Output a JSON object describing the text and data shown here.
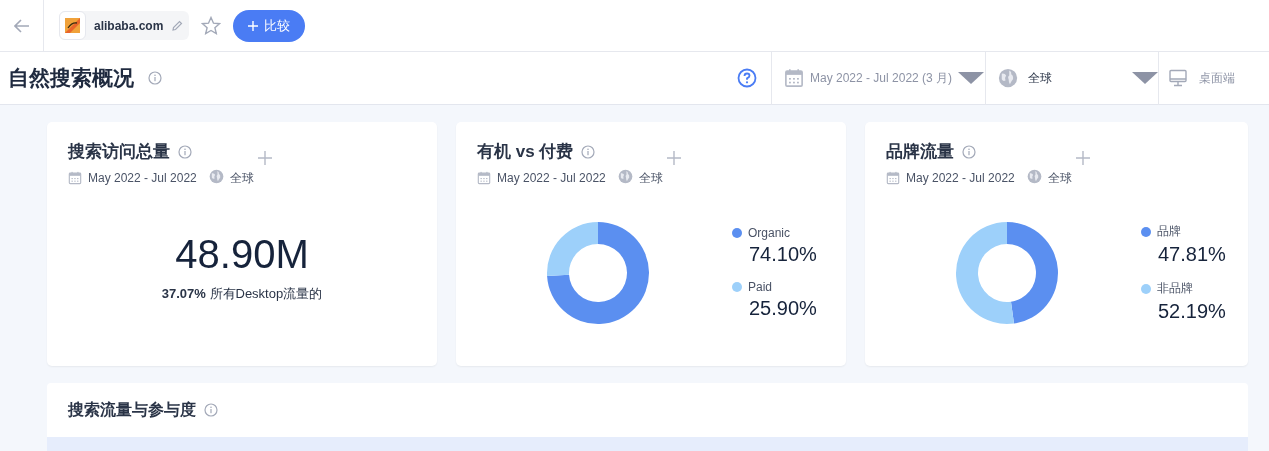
{
  "header": {
    "site": "alibaba.com",
    "compare_button": "比较"
  },
  "title_bar": {
    "title": "自然搜索概况",
    "date_filter": "May 2022 - Jul 2022 (3 月)",
    "region_filter": "全球",
    "device_filter": "桌面端"
  },
  "cards": [
    {
      "kind": "total",
      "title": "搜索访问总量",
      "date": "May 2022 - Jul 2022",
      "region": "全球",
      "value": "48.90M",
      "share": "**37.07%** 所有Desktop流量的"
    },
    {
      "kind": "donut",
      "title": "有机 vs 付费",
      "date": "May 2022 - Jul 2022",
      "region": "全球",
      "legend": [
        {
          "label": "Organic",
          "value": "74.10%",
          "color": "#5b8ff0"
        },
        {
          "label": "Paid",
          "value": "25.90%",
          "color": "#9dd0fa"
        }
      ],
      "chart_data": {
        "type": "donut",
        "values": [
          74.1,
          25.9
        ]
      }
    },
    {
      "kind": "donut",
      "title": "品牌流量",
      "date": "May 2022 - Jul 2022",
      "region": "全球",
      "legend": [
        {
          "label": "品牌",
          "value": "47.81%",
          "color": "#5b8ff0"
        },
        {
          "label": "非品牌",
          "value": "52.19%",
          "color": "#9dd0fa"
        }
      ],
      "chart_data": {
        "type": "donut",
        "values": [
          47.81,
          52.19
        ]
      }
    }
  ],
  "section": {
    "title": "搜索流量与参与度"
  }
}
